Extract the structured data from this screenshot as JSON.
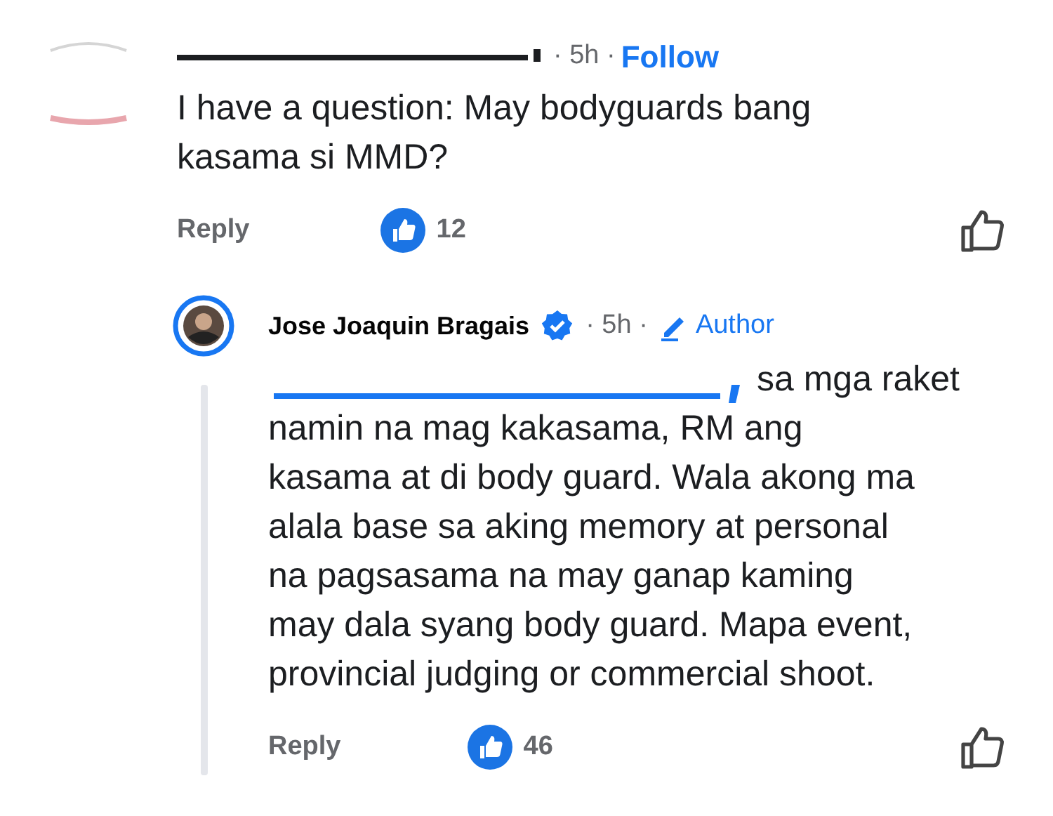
{
  "comment": {
    "meta": "· 5h ·",
    "follow": "Follow",
    "body": "I have a question: May bodyguards bang kasama si MMD?",
    "reply_label": "Reply",
    "reaction_count": "12"
  },
  "reply": {
    "name": "Jose Joaquin Bragais",
    "verified": true,
    "meta_time": "· 5h ·",
    "author_badge": "Author",
    "first_line": "sa mga raket",
    "body_lines": [
      "namin na mag kakasama, RM ang",
      "kasama at di body guard. Wala akong ma",
      "alala base sa aking memory at personal",
      "na pagsasama na may ganap kaming",
      "may dala syang body guard. Mapa event,",
      "provincial judging or commercial shoot."
    ],
    "reply_label": "Reply",
    "reaction_count": "46"
  }
}
